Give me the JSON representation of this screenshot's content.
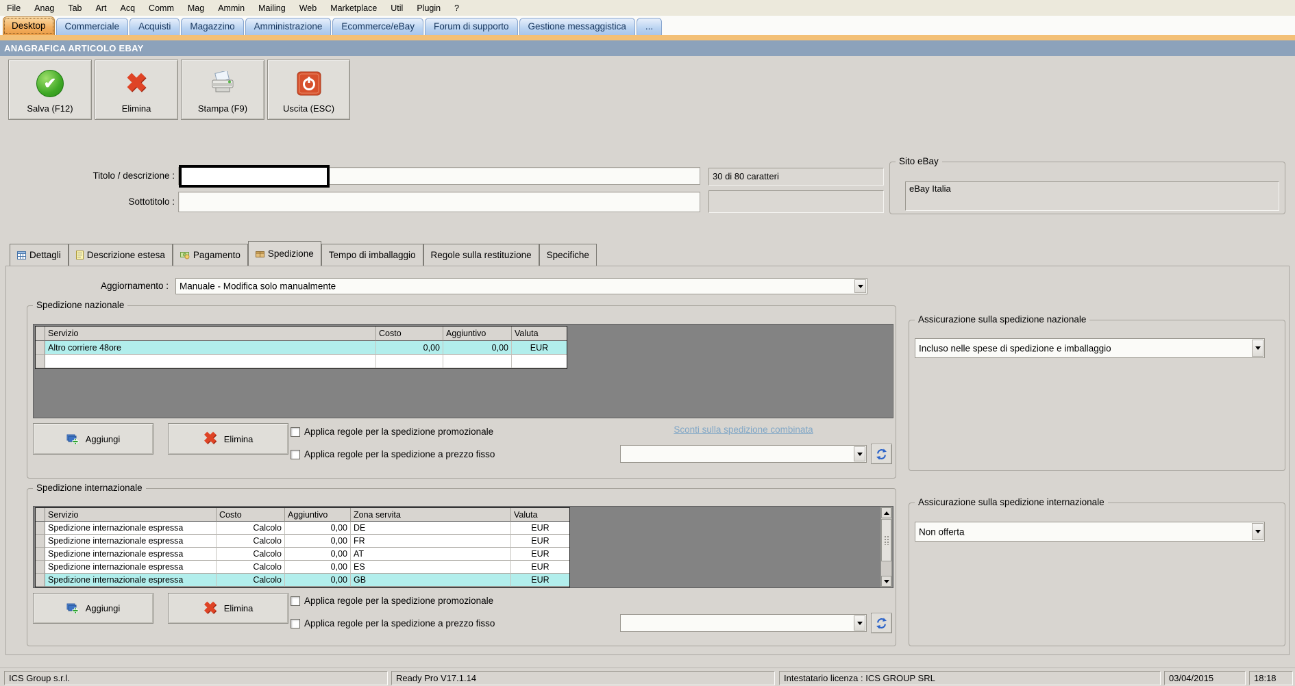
{
  "menu_bar": {
    "items": [
      "File",
      "Anag",
      "Tab",
      "Art",
      "Acq",
      "Comm",
      "Mag",
      "Ammin",
      "Mailing",
      "Web",
      "Marketplace",
      "Util",
      "Plugin",
      "?"
    ]
  },
  "main_tabs": {
    "active": "Desktop",
    "tabs": [
      {
        "label": "Desktop"
      },
      {
        "label": "Commerciale"
      },
      {
        "label": "Acquisti"
      },
      {
        "label": "Magazzino"
      },
      {
        "label": "Amministrazione"
      },
      {
        "label": "Ecommerce/eBay"
      },
      {
        "label": "Forum di supporto"
      },
      {
        "label": "Gestione messaggistica"
      },
      {
        "label": "..."
      }
    ]
  },
  "window": {
    "title": "ANAGRAFICA ARTICOLO EBAY"
  },
  "toolbar": {
    "save_label": "Salva (F12)",
    "delete_label": "Elimina",
    "print_label": "Stampa (F9)",
    "exit_label": "Uscita (ESC)"
  },
  "header": {
    "title_label": "Titolo / descrizione :",
    "title_value": "",
    "subtitle_label": "Sottotitolo :",
    "subtitle_value": "",
    "char_counter": "30 di 80 caratteri",
    "site_group": "Sito eBay",
    "site_value": "eBay Italia"
  },
  "detail_tabs": {
    "active": "Spedizione",
    "labels": [
      "Dettagli",
      "Descrizione estesa",
      "Pagamento",
      "Spedizione",
      "Tempo di imballaggio",
      "Regole sulla restituzione",
      "Specifiche"
    ]
  },
  "update": {
    "label": "Aggiornamento :",
    "value": "Manuale - Modifica solo manualmente"
  },
  "national": {
    "group": "Spedizione nazionale",
    "columns": [
      "Servizio",
      "Costo",
      "Aggiuntivo",
      "Valuta"
    ],
    "rows": [
      [
        "Altro corriere 48ore",
        "0,00",
        "0,00",
        "EUR"
      ],
      [
        "",
        "",
        "",
        ""
      ]
    ],
    "selected_row": 0,
    "add_label": "Aggiungi",
    "delete_label": "Elimina",
    "chk_promo": "Applica regole per la spedizione promozionale",
    "chk_fixed": "Applica regole per la spedizione a prezzo fisso",
    "combined_link": "Sconti sulla spedizione combinata",
    "combined_value": "",
    "insurance_group": "Assicurazione sulla spedizione nazionale",
    "insurance_value": "Incluso nelle spese di spedizione e imballaggio"
  },
  "international": {
    "group": "Spedizione internazionale",
    "columns": [
      "Servizio",
      "Costo",
      "Aggiuntivo",
      "Zona servita",
      "Valuta"
    ],
    "rows": [
      [
        "Spedizione internazionale espressa",
        "Calcolo",
        "0,00",
        "DE",
        "EUR"
      ],
      [
        "Spedizione internazionale espressa",
        "Calcolo",
        "0,00",
        "FR",
        "EUR"
      ],
      [
        "Spedizione internazionale espressa",
        "Calcolo",
        "0,00",
        "AT",
        "EUR"
      ],
      [
        "Spedizione internazionale espressa",
        "Calcolo",
        "0,00",
        "ES",
        "EUR"
      ],
      [
        "Spedizione internazionale espressa",
        "Calcolo",
        "0,00",
        "GB",
        "EUR"
      ]
    ],
    "selected_row": 4,
    "add_label": "Aggiungi",
    "delete_label": "Elimina",
    "chk_promo": "Applica regole per la spedizione promozionale",
    "chk_fixed": "Applica regole per la spedizione a prezzo fisso",
    "combined_value": "",
    "insurance_group": "Assicurazione sulla spedizione internazionale",
    "insurance_value": "Non offerta"
  },
  "status_bar": {
    "company": "ICS Group s.r.l.",
    "version": "Ready Pro V17.1.14",
    "license": "Intestatario licenza : ICS GROUP SRL",
    "date": "03/04/2015",
    "time": "18:18"
  },
  "icons": {
    "save": "green-check-circle",
    "delete": "red-x",
    "print": "printer",
    "exit": "power",
    "add": "rect-plus",
    "refresh": "refresh-arrows"
  },
  "colors": {
    "selection_cyan": "#B2EEEC",
    "accent_orange": "#F3C077",
    "titlebar_blue": "#8CA2BB",
    "link_blue": "#7FA6C6",
    "table_container_gray": "#838383"
  }
}
